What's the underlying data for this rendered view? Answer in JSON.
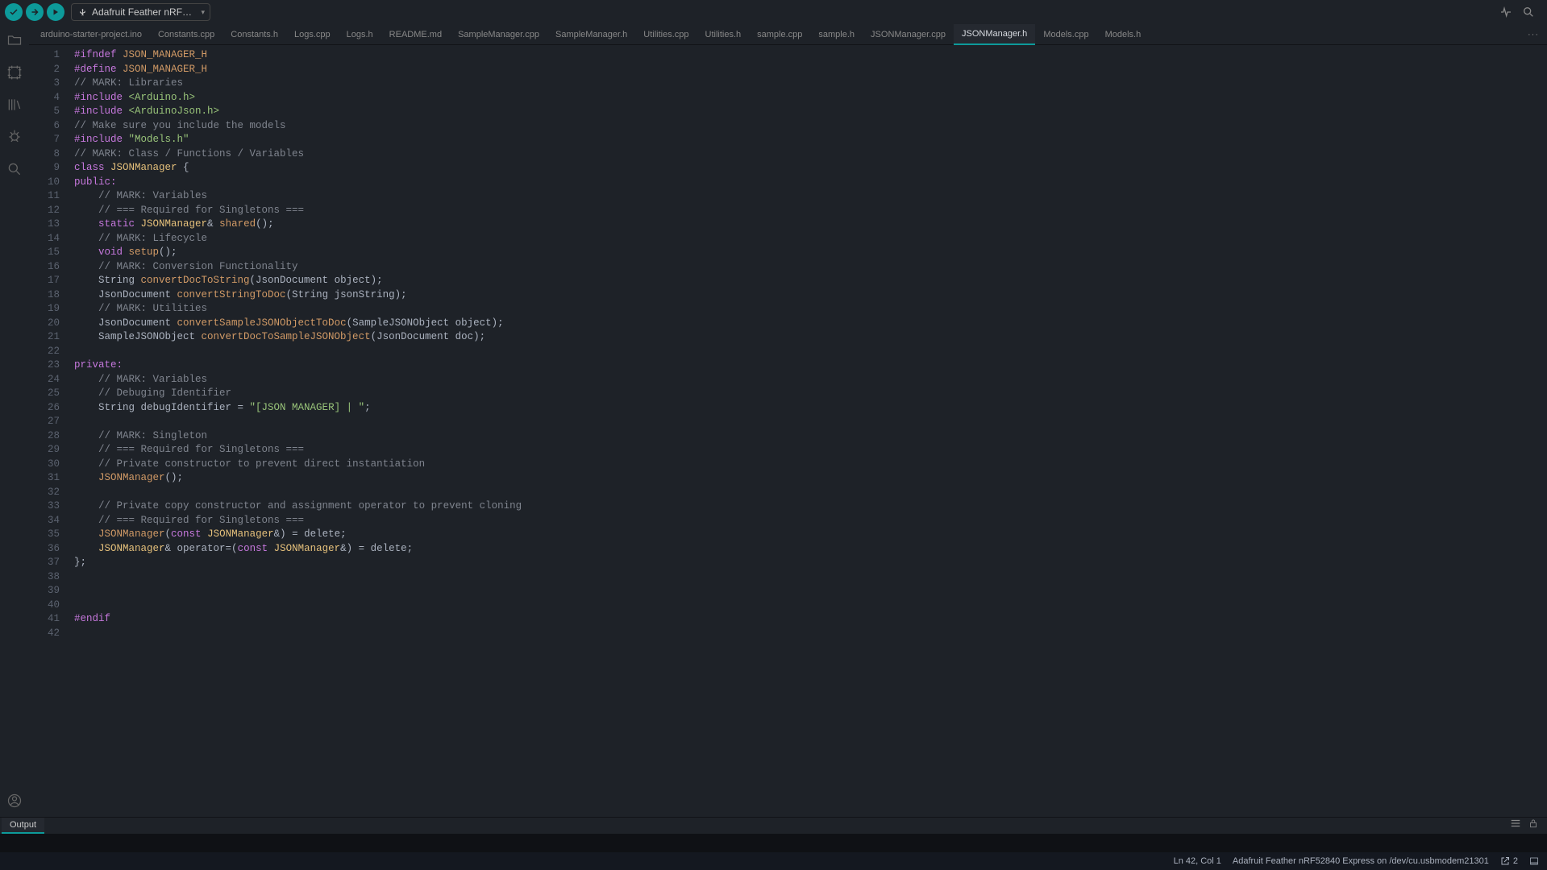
{
  "toolbar": {
    "board_label": "Adafruit Feather nRF…"
  },
  "tabs": [
    "arduino-starter-project.ino",
    "Constants.cpp",
    "Constants.h",
    "Logs.cpp",
    "Logs.h",
    "README.md",
    "SampleManager.cpp",
    "SampleManager.h",
    "Utilities.cpp",
    "Utilities.h",
    "sample.cpp",
    "sample.h",
    "JSONManager.cpp",
    "JSONManager.h",
    "Models.cpp",
    "Models.h"
  ],
  "active_tab": "JSONManager.h",
  "code_lines": [
    [
      [
        "c-pre",
        "#ifndef "
      ],
      [
        "c-def",
        "JSON_MANAGER_H"
      ]
    ],
    [
      [
        "c-pre",
        "#define "
      ],
      [
        "c-def",
        "JSON_MANAGER_H"
      ]
    ],
    [
      [
        "c-cmt",
        "// MARK: Libraries"
      ]
    ],
    [
      [
        "c-pre",
        "#include "
      ],
      [
        "c-str",
        "<Arduino.h>"
      ]
    ],
    [
      [
        "c-pre",
        "#include "
      ],
      [
        "c-str",
        "<ArduinoJson.h>"
      ]
    ],
    [
      [
        "c-cmt",
        "// Make sure you include the models"
      ]
    ],
    [
      [
        "c-pre",
        "#include "
      ],
      [
        "c-str",
        "\"Models.h\""
      ]
    ],
    [
      [
        "c-cmt",
        "// MARK: Class / Functions / Variables"
      ]
    ],
    [
      [
        "c-kw",
        "class "
      ],
      [
        "c-typ",
        "JSONManager"
      ],
      [
        "c-nm",
        " {"
      ]
    ],
    [
      [
        "c-kw",
        "public:"
      ]
    ],
    [
      [
        "c-nm",
        "    "
      ],
      [
        "c-cmt",
        "// MARK: Variables"
      ]
    ],
    [
      [
        "c-nm",
        "    "
      ],
      [
        "c-cmt",
        "// === Required for Singletons ==="
      ]
    ],
    [
      [
        "c-nm",
        "    "
      ],
      [
        "c-kw",
        "static "
      ],
      [
        "c-typ",
        "JSONManager"
      ],
      [
        "c-op",
        "& "
      ],
      [
        "c-fn2",
        "shared"
      ],
      [
        "c-nm",
        "();"
      ]
    ],
    [
      [
        "c-nm",
        "    "
      ],
      [
        "c-cmt",
        "// MARK: Lifecycle"
      ]
    ],
    [
      [
        "c-nm",
        "    "
      ],
      [
        "c-kw",
        "void "
      ],
      [
        "c-fn2",
        "setup"
      ],
      [
        "c-nm",
        "();"
      ]
    ],
    [
      [
        "c-nm",
        "    "
      ],
      [
        "c-cmt",
        "// MARK: Conversion Functionality"
      ]
    ],
    [
      [
        "c-nm",
        "    String "
      ],
      [
        "c-fn2",
        "convertDocToString"
      ],
      [
        "c-nm",
        "(JsonDocument object);"
      ]
    ],
    [
      [
        "c-nm",
        "    JsonDocument "
      ],
      [
        "c-fn2",
        "convertStringToDoc"
      ],
      [
        "c-nm",
        "(String jsonString);"
      ]
    ],
    [
      [
        "c-nm",
        "    "
      ],
      [
        "c-cmt",
        "// MARK: Utilities"
      ]
    ],
    [
      [
        "c-nm",
        "    JsonDocument "
      ],
      [
        "c-fn2",
        "convertSampleJSONObjectToDoc"
      ],
      [
        "c-nm",
        "(SampleJSONObject object);"
      ]
    ],
    [
      [
        "c-nm",
        "    SampleJSONObject "
      ],
      [
        "c-fn2",
        "convertDocToSampleJSONObject"
      ],
      [
        "c-nm",
        "(JsonDocument doc);"
      ]
    ],
    [
      [
        "c-nm",
        ""
      ]
    ],
    [
      [
        "c-kw",
        "private:"
      ]
    ],
    [
      [
        "c-nm",
        "    "
      ],
      [
        "c-cmt",
        "// MARK: Variables"
      ]
    ],
    [
      [
        "c-nm",
        "    "
      ],
      [
        "c-cmt",
        "// Debuging Identifier"
      ]
    ],
    [
      [
        "c-nm",
        "    String debugIdentifier = "
      ],
      [
        "c-str",
        "\"[JSON MANAGER] | \""
      ],
      [
        "c-nm",
        ";"
      ]
    ],
    [
      [
        "c-nm",
        ""
      ]
    ],
    [
      [
        "c-nm",
        "    "
      ],
      [
        "c-cmt",
        "// MARK: Singleton"
      ]
    ],
    [
      [
        "c-nm",
        "    "
      ],
      [
        "c-cmt",
        "// === Required for Singletons ==="
      ]
    ],
    [
      [
        "c-nm",
        "    "
      ],
      [
        "c-cmt",
        "// Private constructor to prevent direct instantiation"
      ]
    ],
    [
      [
        "c-nm",
        "    "
      ],
      [
        "c-fn2",
        "JSONManager"
      ],
      [
        "c-nm",
        "();"
      ]
    ],
    [
      [
        "c-nm",
        ""
      ]
    ],
    [
      [
        "c-nm",
        "    "
      ],
      [
        "c-cmt",
        "// Private copy constructor and assignment operator to prevent cloning"
      ]
    ],
    [
      [
        "c-nm",
        "    "
      ],
      [
        "c-cmt",
        "// === Required for Singletons ==="
      ]
    ],
    [
      [
        "c-nm",
        "    "
      ],
      [
        "c-fn2",
        "JSONManager"
      ],
      [
        "c-nm",
        "("
      ],
      [
        "c-kw",
        "const "
      ],
      [
        "c-typ",
        "JSONManager"
      ],
      [
        "c-op",
        "&"
      ],
      [
        "c-nm",
        ") = delete;"
      ]
    ],
    [
      [
        "c-nm",
        "    "
      ],
      [
        "c-typ",
        "JSONManager"
      ],
      [
        "c-op",
        "& "
      ],
      [
        "c-nm",
        "operator=("
      ],
      [
        "c-kw",
        "const "
      ],
      [
        "c-typ",
        "JSONManager"
      ],
      [
        "c-op",
        "&"
      ],
      [
        "c-nm",
        ") = delete;"
      ]
    ],
    [
      [
        "c-nm",
        "};"
      ]
    ],
    [
      [
        "c-nm",
        ""
      ]
    ],
    [
      [
        "c-nm",
        ""
      ]
    ],
    [
      [
        "c-nm",
        ""
      ]
    ],
    [
      [
        "c-pre",
        "#endif"
      ]
    ],
    [
      [
        "c-nm",
        ""
      ]
    ]
  ],
  "panel": {
    "tab": "Output"
  },
  "status": {
    "position": "Ln 42, Col 1",
    "board": "Adafruit Feather nRF52840 Express on /dev/cu.usbmodem21301",
    "notifications": "2"
  }
}
